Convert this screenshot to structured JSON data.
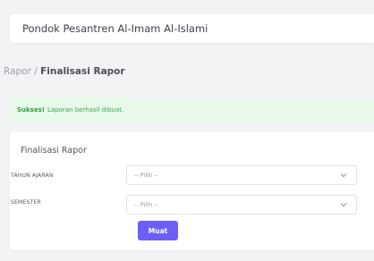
{
  "navbar": {
    "title": "Pondok Pesantren Al-Imam Al-Islami"
  },
  "breadcrumb": {
    "parent": "Rapor",
    "separator": " / ",
    "current": "Finalisasi Rapor"
  },
  "alert": {
    "strong": "Sukses!",
    "message": "Laporan berhasil dibuat."
  },
  "card": {
    "title": "Finalisasi Rapor",
    "fields": [
      {
        "label": "TAHUN AJARAN",
        "value": "-- Pilih --"
      },
      {
        "label": "SEMESTER",
        "value": "-- Pilih --"
      }
    ],
    "submit_label": "Muat"
  },
  "colors": {
    "primary": "#6c5ff5",
    "success_bg": "#e7f9e9",
    "success_text": "#3da84b"
  },
  "icons": {
    "select_arrow": "chevron-down-icon"
  }
}
